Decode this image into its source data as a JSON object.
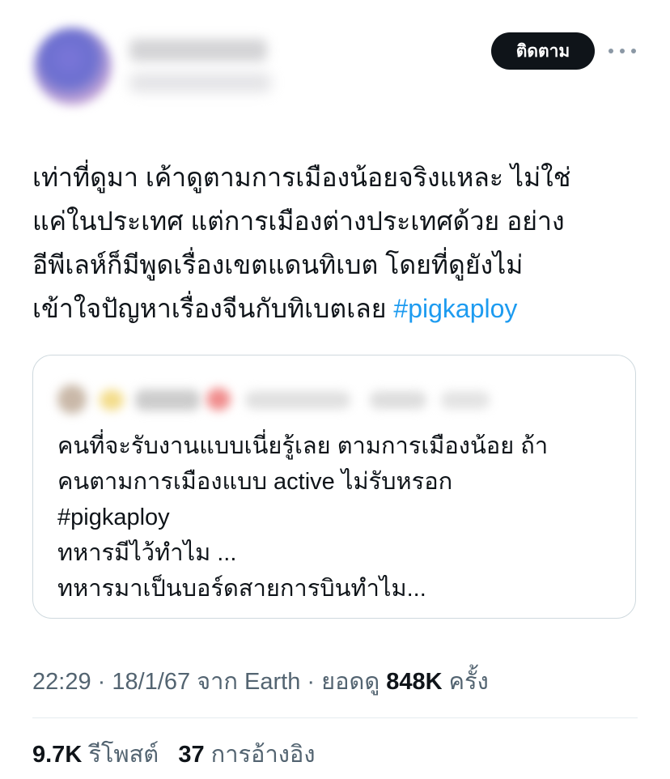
{
  "author": {
    "follow_label": "ติดตาม"
  },
  "tweet": {
    "lines": [
      "เท่าที่ดูมา เค้าดูตามการเมืองน้อยจริงแหละ ไม่ใช่",
      "แค่ในประเทศ แต่การเมืองต่างประเทศด้วย อย่าง",
      "อีพีเลห์ก็มีพูดเรื่องเขตแดนทิเบต โดยที่ดูยังไม่",
      "เข้าใจปัญหาเรื่องจีนกับทิเบตเลย "
    ],
    "hashtag": "#pigkaploy"
  },
  "quote": {
    "lines": [
      "คนที่จะรับงานแบบเนี่ยรู้เลย ตามการเมืองน้อย  ถ้า",
      "คนตามการเมืองแบบ active ไม่รับหรอก",
      "#pigkaploy",
      "ทหารมีไว้ทำไม ...",
      "ทหารมาเป็นบอร์ดสายการบินทำไม..."
    ]
  },
  "meta": {
    "time_date_source": "22:29 · 18/1/67 จาก Earth · ยอดดู ",
    "views": "848K",
    "views_unit": " ครั้ง"
  },
  "stats": {
    "reposts_count": "9.7K",
    "reposts_label": "รีโพสต์",
    "quotes_count": "37",
    "quotes_label": "การอ้างอิง"
  },
  "colors": {
    "link": "#1d9bf0",
    "button_bg": "#0f1419",
    "secondary_text": "#536471",
    "border": "#cfd9de"
  }
}
